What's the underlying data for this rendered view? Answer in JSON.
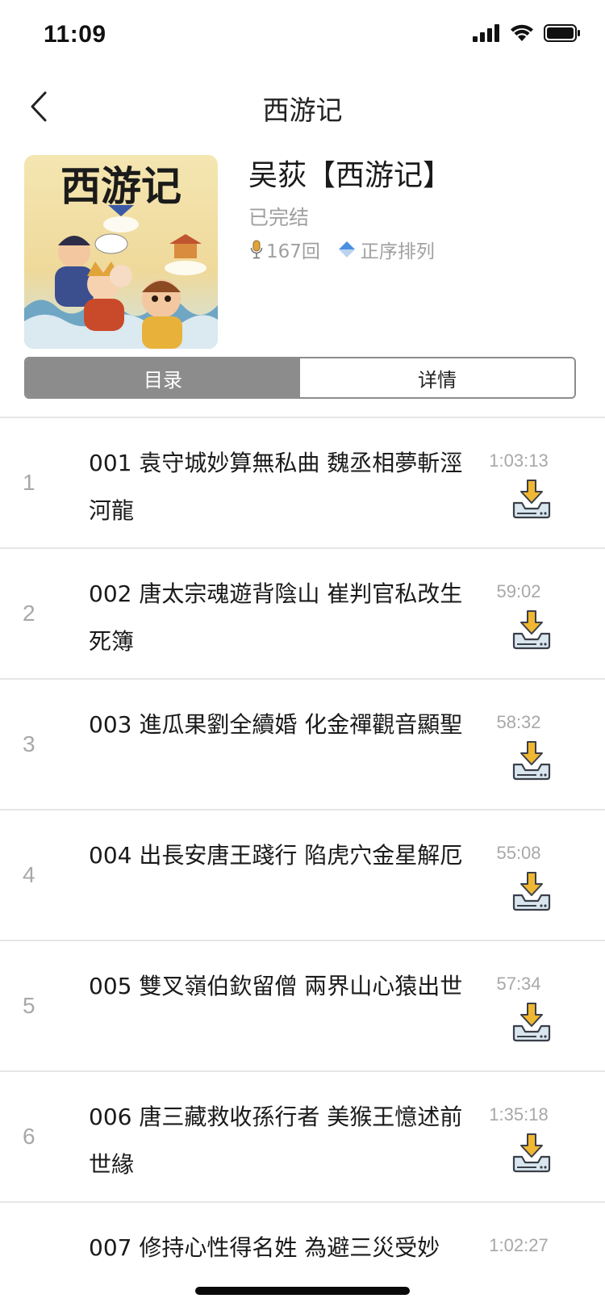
{
  "status_bar": {
    "time": "11:09"
  },
  "nav": {
    "title": "西游记"
  },
  "book": {
    "cover_title": "西游记",
    "title": "吴荻【西游记】",
    "status": "已完结",
    "episode_count": "167回",
    "sort_label": "正序排列"
  },
  "tabs": [
    {
      "label": "目录",
      "active": true
    },
    {
      "label": "详情",
      "active": false
    }
  ],
  "chapters": [
    {
      "index": "1",
      "title": "001 袁守城妙算無私曲 魏丞相夢斬涇河龍",
      "duration": "1:03:13"
    },
    {
      "index": "2",
      "title": "002 唐太宗魂遊背陰山 崔判官私改生死簿",
      "duration": "59:02"
    },
    {
      "index": "3",
      "title": "003 進瓜果劉全續婚 化金禪觀音顯聖",
      "duration": "58:32"
    },
    {
      "index": "4",
      "title": "004 出長安唐王踐行 陷虎穴金星解厄",
      "duration": "55:08"
    },
    {
      "index": "5",
      "title": "005 雙叉嶺伯欽留僧 兩界山心猿出世",
      "duration": "57:34"
    },
    {
      "index": "6",
      "title": "006 唐三藏救收孫行者 美猴王憶述前世緣",
      "duration": "1:35:18"
    },
    {
      "index": "",
      "title": "007 修持心性得名姓 為避三災受妙",
      "duration": "1:02:27"
    }
  ],
  "colors": {
    "tab_active_bg": "#8c8c8c",
    "download_arrow": "#f0b732",
    "secondary_text": "#a0a0a0",
    "sort_icon": "#4a90e2"
  },
  "icons": {
    "back": "chevron-left-icon",
    "mic": "microphone-icon",
    "sort": "sort-icon",
    "download": "download-icon"
  }
}
